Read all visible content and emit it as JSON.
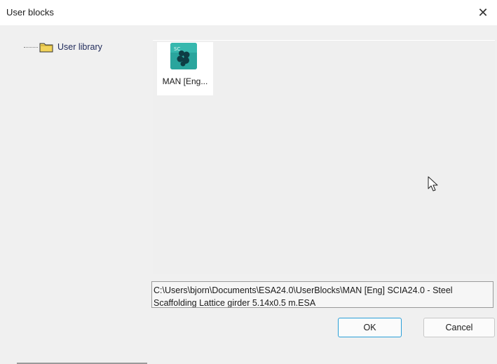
{
  "window": {
    "title": "User blocks",
    "close_glyph": "✕"
  },
  "tree": {
    "items": [
      {
        "label": "User library",
        "icon": "folder-icon"
      }
    ]
  },
  "list": {
    "items": [
      {
        "label": "MAN [Eng...",
        "icon": "block-file-icon"
      }
    ]
  },
  "path": {
    "text": "C:\\Users\\bjorn\\Documents\\ESA24.0\\UserBlocks\\MAN [Eng] SCIA24.0 - Steel Scaffolding Lattice girder 5.14x0.5 m.ESA"
  },
  "buttons": {
    "ok_label": "OK",
    "cancel_label": "Cancel"
  },
  "colors": {
    "accent": "#2a9fd8",
    "icon_teal": "#2aa59d",
    "folder_yellow": "#f2d35a"
  }
}
